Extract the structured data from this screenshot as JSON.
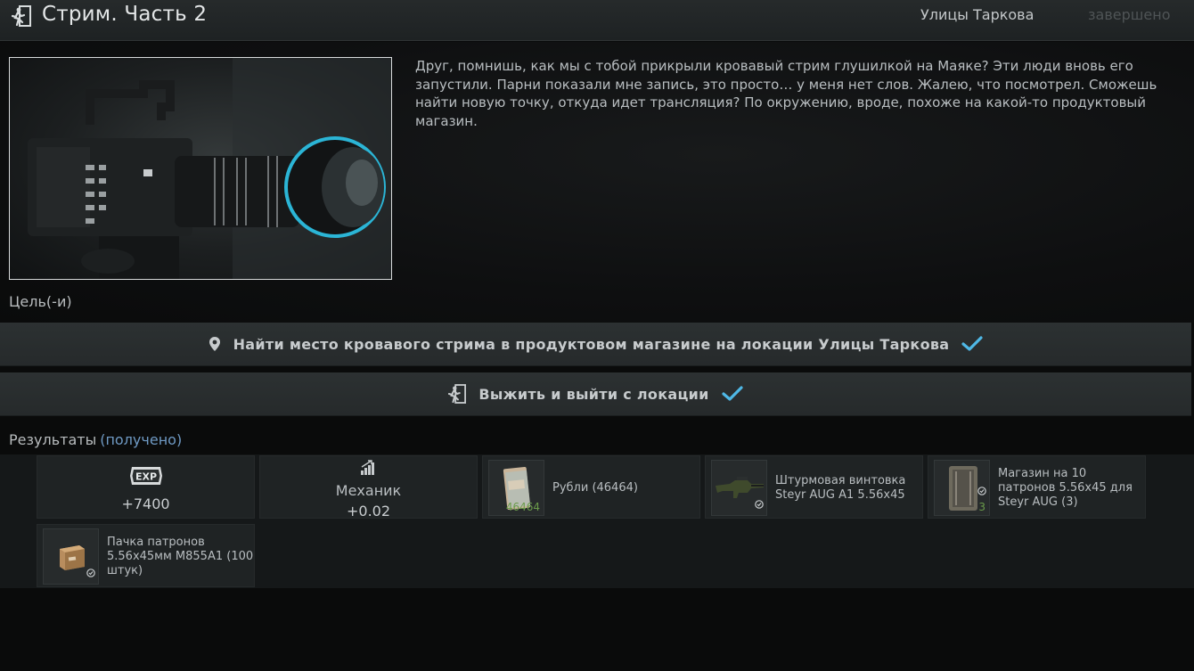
{
  "header": {
    "title": "Стрим. Часть 2",
    "location": "Улицы Таркова",
    "status": "завершено"
  },
  "description": "Друг, помнишь, как мы с тобой прикрыли кровавый стрим глушилкой на Маяке? Эти люди вновь его запустили. Парни показали мне запись, это просто… у меня нет слов. Жалею, что посмотрел. Сможешь найти новую точку, откуда идет трансляция? По окружению, вроде, похоже на какой-то продуктовый магазин.",
  "objectives": {
    "label": "Цель(-и)",
    "items": [
      {
        "text": "Найти место кровавого стрима в продуктовом магазине на локации Улицы Таркова",
        "icon": "location-pin-icon",
        "completed": true
      },
      {
        "text": "Выжить и выйти с локации",
        "icon": "exit-icon",
        "completed": true
      }
    ]
  },
  "results": {
    "label": "Результаты",
    "status": "(получено)",
    "exp": {
      "badge": "EXP",
      "value": "+7400"
    },
    "trader": {
      "name": "Механик",
      "value": "+0.02"
    },
    "items": [
      {
        "name": "Рубли (46464)",
        "count": "46464",
        "icon": "rubles-icon"
      },
      {
        "name": "Штурмовая винтовка Steyr AUG A1 5.56x45",
        "count": "",
        "icon": "rifle-icon"
      },
      {
        "name": "Магазин на 10 патронов 5.56x45 для Steyr AUG (3)",
        "count": "3",
        "icon": "magazine-icon"
      },
      {
        "name": "Пачка патронов 5.56x45мм M855A1 (100 штук)",
        "count": "",
        "icon": "ammo-box-icon"
      }
    ]
  },
  "colors": {
    "accent_check": "#4fb8e6",
    "received": "#6f9ac4",
    "count_green": "#6a9b4a"
  }
}
